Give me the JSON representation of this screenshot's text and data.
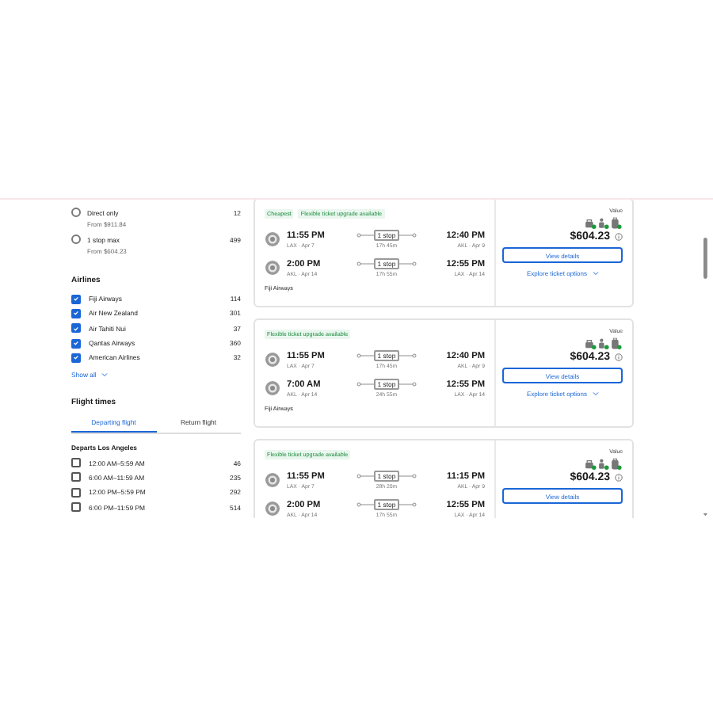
{
  "stops": [
    {
      "label": "Direct only",
      "from": "From $911.84",
      "count": "12",
      "selected": false
    },
    {
      "label": "1 stop max",
      "from": "From $604.23",
      "count": "499",
      "selected": false
    }
  ],
  "airlines": {
    "title": "Airlines",
    "items": [
      {
        "name": "Fiji Airways",
        "count": "114",
        "checked": true
      },
      {
        "name": "Air New Zealand",
        "count": "301",
        "checked": true
      },
      {
        "name": "Air Tahiti Nui",
        "count": "37",
        "checked": true
      },
      {
        "name": "Qantas Airways",
        "count": "360",
        "checked": true
      },
      {
        "name": "American Airlines",
        "count": "32",
        "checked": true
      }
    ],
    "show_all": "Show all"
  },
  "flight_times": {
    "title": "Flight times",
    "tabs": [
      {
        "label": "Departing flight",
        "selected": true
      },
      {
        "label": "Return flight",
        "selected": false
      }
    ],
    "subtitle": "Departs Los Angeles",
    "items": [
      {
        "label": "12:00 AM–5:59 AM",
        "count": "46",
        "checked": false
      },
      {
        "label": "6:00 AM–11:59 AM",
        "count": "235",
        "checked": false
      },
      {
        "label": "12:00 PM–5:59 PM",
        "count": "292",
        "checked": false
      },
      {
        "label": "6:00 PM–11:59 PM",
        "count": "514",
        "checked": false
      }
    ]
  },
  "results": [
    {
      "badges": [
        "Cheapest",
        "Flexible ticket upgrade available"
      ],
      "legs": [
        {
          "depart_time": "11:55 PM",
          "depart_place": "LAX · Apr 7",
          "stops": "1 stop",
          "duration": "17h 45m",
          "arrive_time": "12:40 PM",
          "arrive_place": "AKL · Apr 9"
        },
        {
          "depart_time": "2:00 PM",
          "depart_place": "AKL · Apr 14",
          "stops": "1 stop",
          "duration": "17h 55m",
          "arrive_time": "12:55 PM",
          "arrive_place": "LAX · Apr 14"
        }
      ],
      "airline": "Fiji Airways",
      "value_label": "Value",
      "price": "$604.23",
      "button": "View details",
      "explore": "Explore ticket options"
    },
    {
      "badges": [
        "Flexible ticket upgrade available"
      ],
      "legs": [
        {
          "depart_time": "11:55 PM",
          "depart_place": "LAX · Apr 7",
          "stops": "1 stop",
          "duration": "17h 45m",
          "arrive_time": "12:40 PM",
          "arrive_place": "AKL · Apr 9"
        },
        {
          "depart_time": "7:00 AM",
          "depart_place": "AKL · Apr 14",
          "stops": "1 stop",
          "duration": "24h 55m",
          "arrive_time": "12:55 PM",
          "arrive_place": "LAX · Apr 14"
        }
      ],
      "airline": "Fiji Airways",
      "value_label": "Value",
      "price": "$604.23",
      "button": "View details",
      "explore": "Explore ticket options"
    },
    {
      "badges": [
        "Flexible ticket upgrade available"
      ],
      "legs": [
        {
          "depart_time": "11:55 PM",
          "depart_place": "LAX · Apr 7",
          "stops": "1 stop",
          "duration": "28h 20m",
          "arrive_time": "11:15 PM",
          "arrive_place": "AKL · Apr 9"
        },
        {
          "depart_time": "2:00 PM",
          "depart_place": "AKL · Apr 14",
          "stops": "1 stop",
          "duration": "17h 55m",
          "arrive_time": "12:55 PM",
          "arrive_place": "LAX · Apr 14"
        }
      ],
      "value_label": "Value",
      "price": "$604.23",
      "button": "View details"
    }
  ]
}
